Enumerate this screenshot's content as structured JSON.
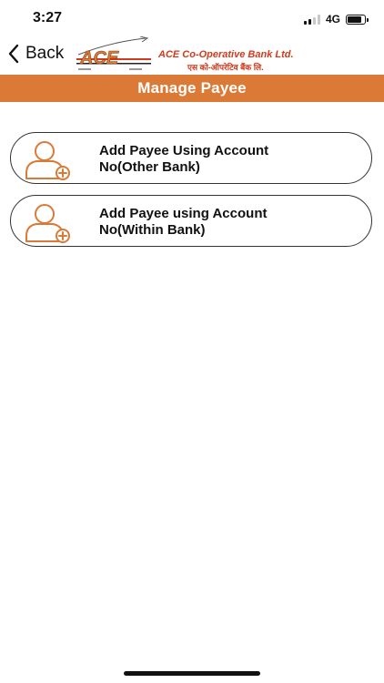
{
  "status_bar": {
    "time": "3:27",
    "network": "4G"
  },
  "nav": {
    "back_label": "Back",
    "logo": {
      "emblem_text": "ACE",
      "bank_name_en": "ACE Co-Operative Bank Ltd.",
      "bank_name_hi": "एस को-ऑपरेटिव बैंक लि."
    }
  },
  "header": {
    "title": "Manage Payee"
  },
  "options": [
    {
      "line1": "Add Payee Using Account",
      "line2": "No(Other Bank)",
      "icon": "add-user-icon"
    },
    {
      "line1": "Add Payee using Account",
      "line2": "No(Within Bank)",
      "icon": "add-user-icon"
    }
  ],
  "colors": {
    "accent": "#db7a36",
    "brand_red": "#d23a1c",
    "border": "#333333"
  }
}
